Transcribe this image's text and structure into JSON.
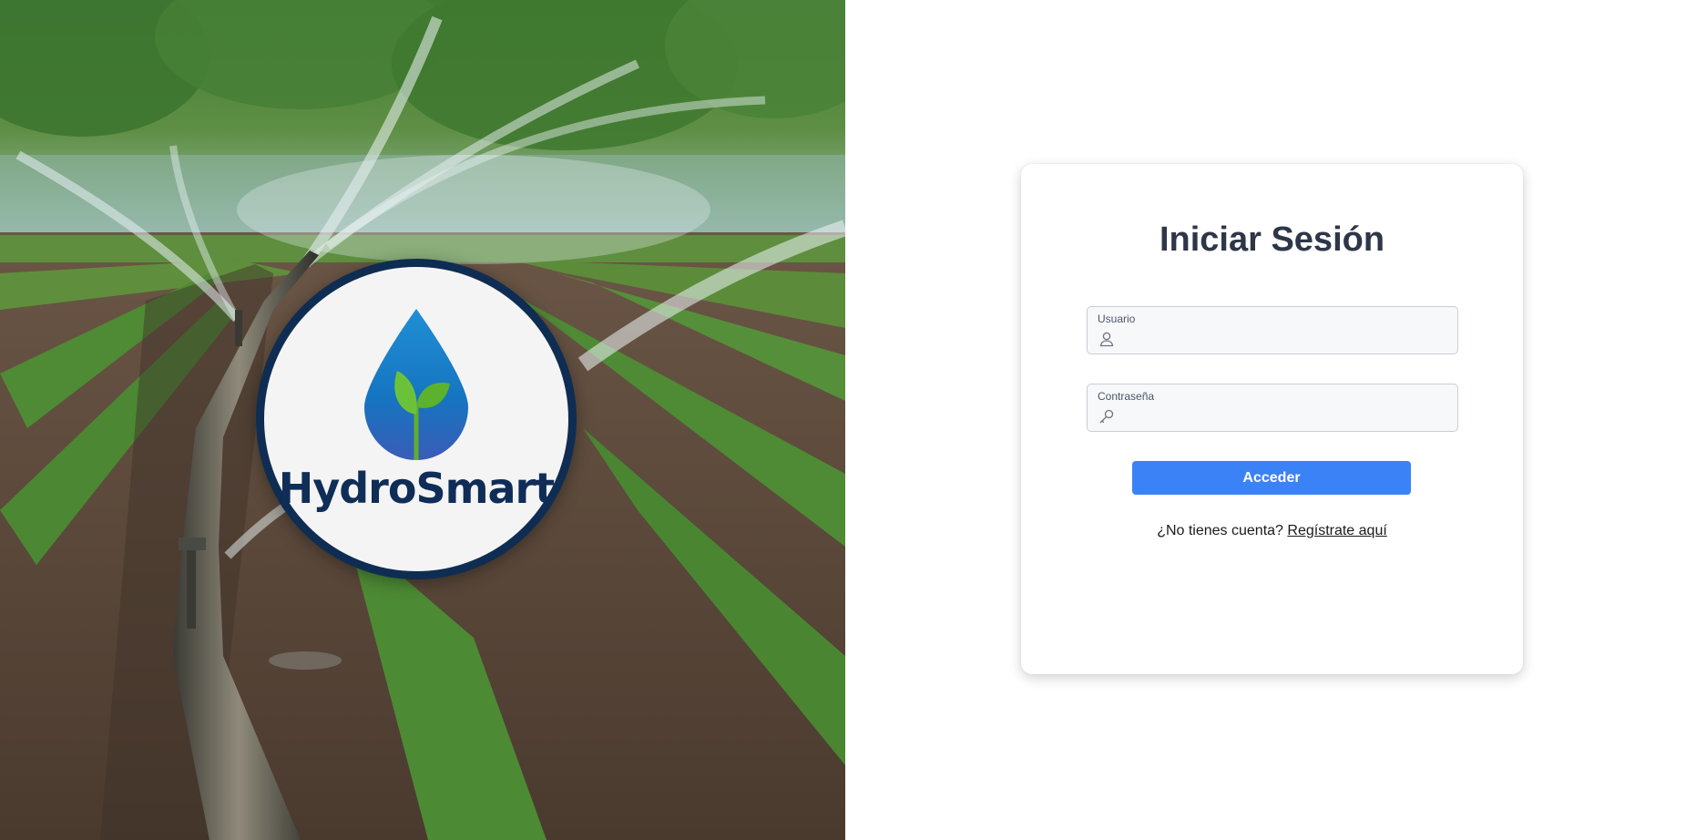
{
  "brand": {
    "name": "HydroSmart"
  },
  "login": {
    "title": "Iniciar Sesión",
    "username_label": "Usuario",
    "username_value": "",
    "password_label": "Contraseña",
    "password_value": "",
    "submit_label": "Acceder",
    "register_prompt": "¿No tienes cuenta?",
    "register_link": "Regístrate aquí"
  },
  "icons": {
    "username": "user-icon",
    "password": "key-icon",
    "logo": "water-drop-sprout-icon"
  },
  "colors": {
    "primary_button": "#3b82f6",
    "title_text": "#2d3748",
    "logo_ring": "#0f2d52",
    "logo_text": "#102d57"
  }
}
